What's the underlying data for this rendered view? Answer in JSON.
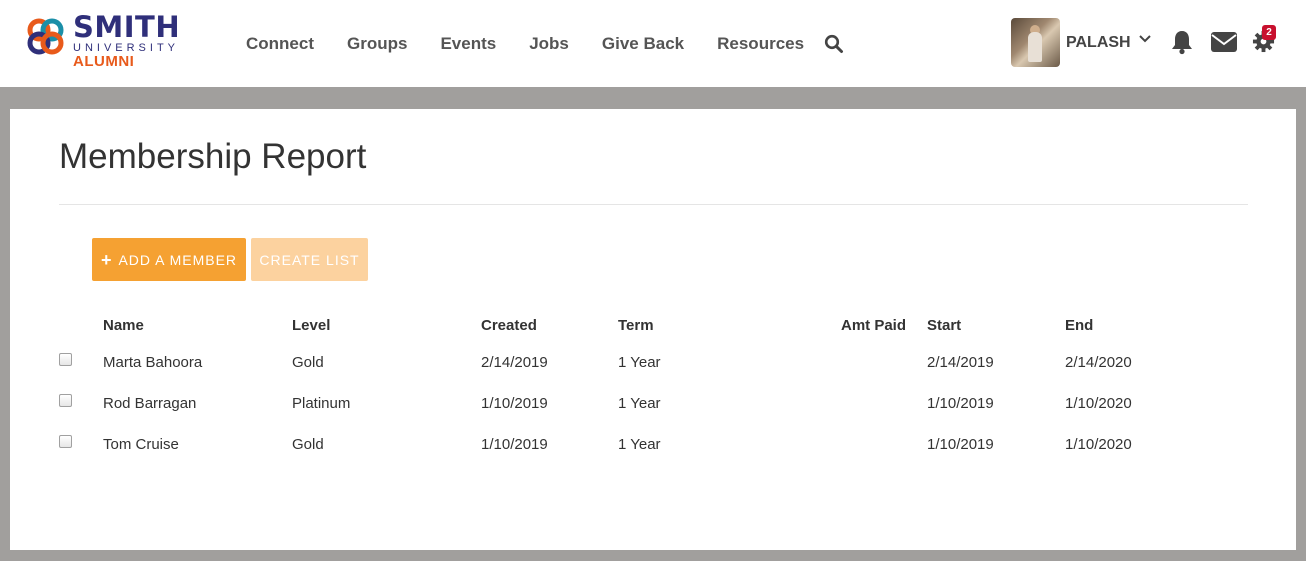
{
  "brand": {
    "name": "SMITH",
    "sub": "UNIVERSITY",
    "tag": "ALUMNI",
    "colors": {
      "navy": "#2f2f7a",
      "orange": "#e85a1b",
      "teal": "#1b8fa8"
    }
  },
  "nav": {
    "items": [
      "Connect",
      "Groups",
      "Events",
      "Jobs",
      "Give Back",
      "Resources"
    ],
    "search_icon": "search-icon"
  },
  "user": {
    "name": "PALASH",
    "gear_badge": "2"
  },
  "page": {
    "title": "Membership Report",
    "add_button": "ADD A MEMBER",
    "create_button": "CREATE LIST"
  },
  "table": {
    "headers": [
      "Name",
      "Level",
      "Created",
      "Term",
      "Amt Paid",
      "Start",
      "End"
    ],
    "rows": [
      {
        "name": "Marta Bahoora",
        "level": "Gold",
        "created": "2/14/2019",
        "term": "1 Year",
        "amt_paid": "",
        "start": "2/14/2019",
        "end": "2/14/2020"
      },
      {
        "name": "Rod Barragan",
        "level": "Platinum",
        "created": "1/10/2019",
        "term": "1 Year",
        "amt_paid": "",
        "start": "1/10/2019",
        "end": "1/10/2020"
      },
      {
        "name": "Tom Cruise",
        "level": "Gold",
        "created": "1/10/2019",
        "term": "1 Year",
        "amt_paid": "",
        "start": "1/10/2019",
        "end": "1/10/2020"
      }
    ]
  },
  "accent_colors": {
    "primary_button": "#f5a132",
    "disabled_button": "#fcd29f",
    "badge": "#c8102e"
  }
}
